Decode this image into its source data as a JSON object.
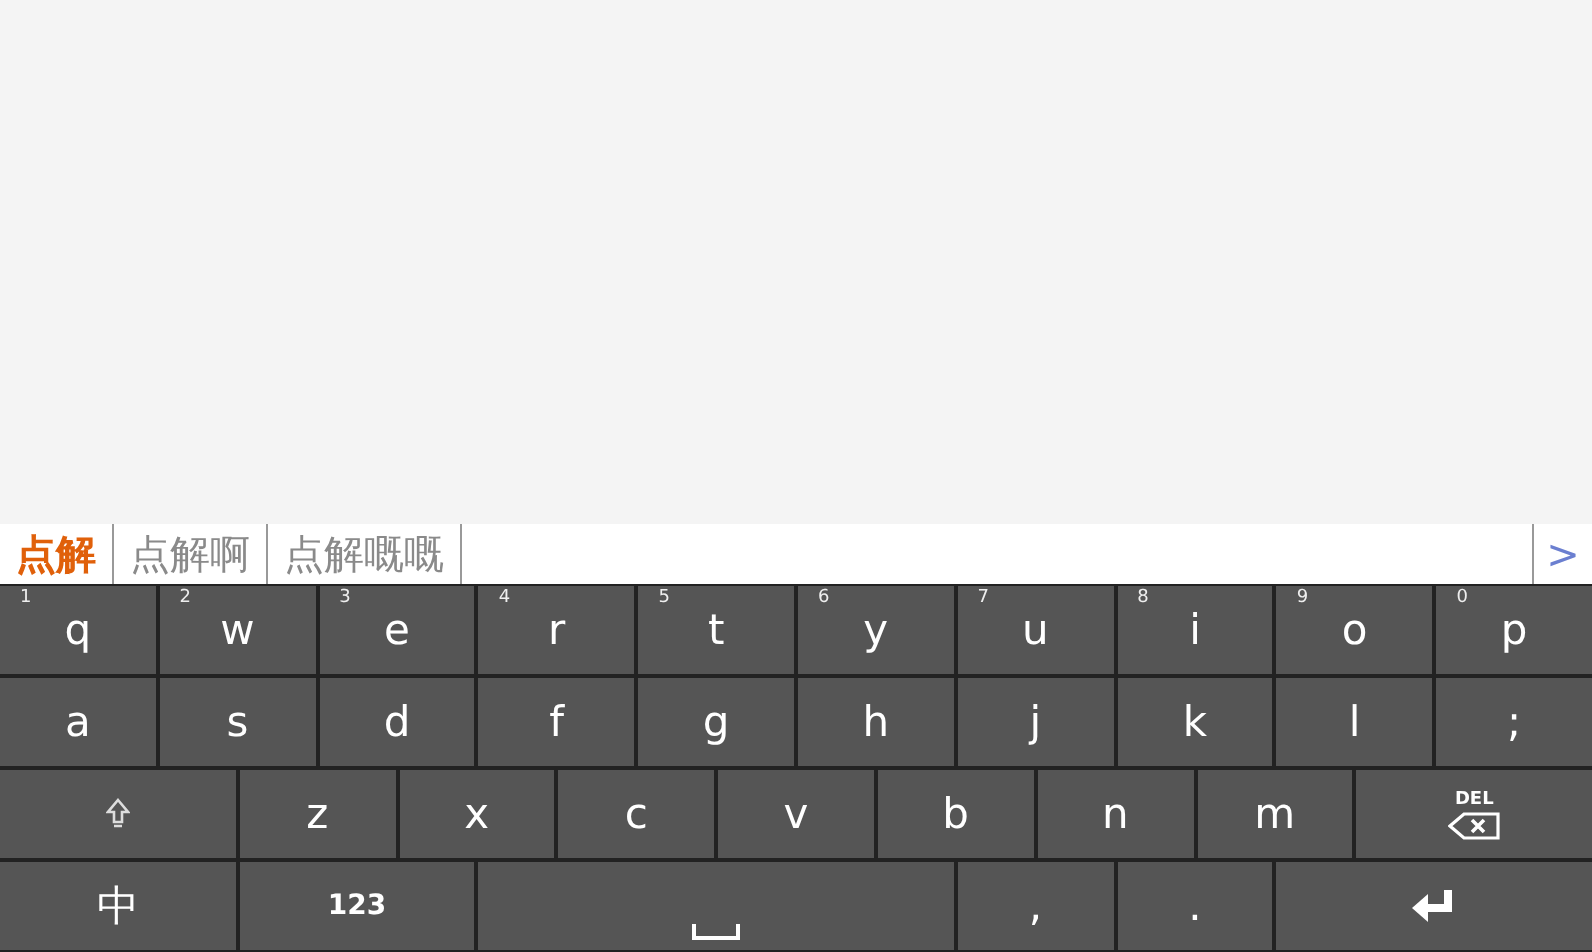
{
  "candidates": [
    {
      "text": "点解",
      "selected": true
    },
    {
      "text": "点解啊",
      "selected": false
    },
    {
      "text": "点解嘅嘅",
      "selected": false
    }
  ],
  "more_button": ">",
  "keyboard": {
    "rows": [
      {
        "keys": [
          {
            "kind": "char",
            "label": "q",
            "hint": "1"
          },
          {
            "kind": "char",
            "label": "w",
            "hint": "2"
          },
          {
            "kind": "char",
            "label": "e",
            "hint": "3"
          },
          {
            "kind": "char",
            "label": "r",
            "hint": "4"
          },
          {
            "kind": "char",
            "label": "t",
            "hint": "5"
          },
          {
            "kind": "char",
            "label": "y",
            "hint": "6"
          },
          {
            "kind": "char",
            "label": "u",
            "hint": "7"
          },
          {
            "kind": "char",
            "label": "i",
            "hint": "8"
          },
          {
            "kind": "char",
            "label": "o",
            "hint": "9"
          },
          {
            "kind": "char",
            "label": "p",
            "hint": "0"
          }
        ]
      },
      {
        "keys": [
          {
            "kind": "char",
            "label": "a"
          },
          {
            "kind": "char",
            "label": "s"
          },
          {
            "kind": "char",
            "label": "d"
          },
          {
            "kind": "char",
            "label": "f"
          },
          {
            "kind": "char",
            "label": "g"
          },
          {
            "kind": "char",
            "label": "h"
          },
          {
            "kind": "char",
            "label": "j"
          },
          {
            "kind": "char",
            "label": "k"
          },
          {
            "kind": "char",
            "label": "l"
          },
          {
            "kind": "char",
            "label": ";"
          }
        ]
      },
      {
        "keys": [
          {
            "kind": "shift"
          },
          {
            "kind": "char",
            "label": "z"
          },
          {
            "kind": "char",
            "label": "x"
          },
          {
            "kind": "char",
            "label": "c"
          },
          {
            "kind": "char",
            "label": "v"
          },
          {
            "kind": "char",
            "label": "b"
          },
          {
            "kind": "char",
            "label": "n"
          },
          {
            "kind": "char",
            "label": "m"
          },
          {
            "kind": "delete",
            "label": "DEL"
          }
        ]
      },
      {
        "keys": [
          {
            "kind": "mode",
            "label": "中"
          },
          {
            "kind": "mode",
            "label": "123"
          },
          {
            "kind": "space"
          },
          {
            "kind": "char",
            "label": ","
          },
          {
            "kind": "char",
            "label": "."
          },
          {
            "kind": "enter"
          }
        ]
      }
    ]
  }
}
